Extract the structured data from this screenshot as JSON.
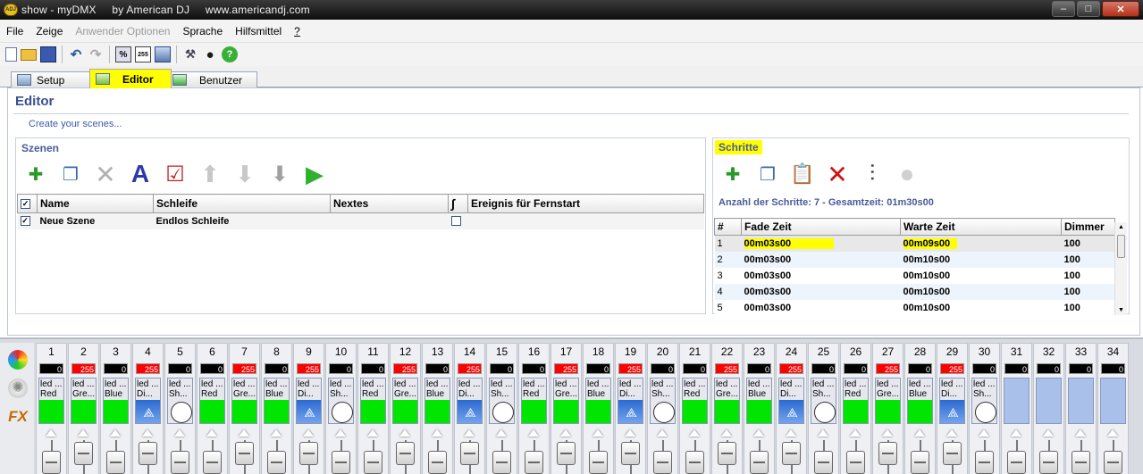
{
  "window": {
    "title": "show - myDMX     by American DJ     www.americandj.com",
    "minimize": "–",
    "maximize": "□",
    "close": "✕"
  },
  "menu": [
    {
      "label": "File",
      "enabled": true
    },
    {
      "label": "Zeige",
      "enabled": true
    },
    {
      "label": "Anwender Optionen",
      "enabled": false
    },
    {
      "label": "Sprache",
      "enabled": true
    },
    {
      "label": "Hilfsmittel",
      "enabled": true
    },
    {
      "label": "?",
      "enabled": true
    }
  ],
  "toolbar_icons": [
    "new-file-icon",
    "open-folder-icon",
    "save-icon",
    "undo-icon",
    "redo-icon",
    "percent-icon",
    "dmx-255-icon",
    "window-icon",
    "tools-icon",
    "record-icon",
    "help-icon"
  ],
  "toolbar_255": "255",
  "tabs": [
    {
      "label": "Setup",
      "active": false
    },
    {
      "label": "Editor",
      "active": true
    },
    {
      "label": "Benutzer",
      "active": false
    }
  ],
  "editor": {
    "title": "Editor",
    "subtitle": "Create your scenes..."
  },
  "szenen": {
    "title": "Szenen",
    "icons": [
      "add-scene-icon",
      "copy-scene-icon",
      "delete-scene-icon",
      "rename-scene-icon",
      "properties-scene-icon",
      "move-up-icon",
      "move-down-icon",
      "import-scene-icon",
      "play-scene-icon"
    ],
    "columns": [
      "Name",
      "Schleife",
      "Nextes",
      "Ereignis für Fernstart"
    ],
    "rows": [
      {
        "name": "Neue Szene",
        "schleife": "Endlos Schleife",
        "nextes": "",
        "checked": true
      }
    ]
  },
  "schritte": {
    "title": "Schritte",
    "icons": [
      "add-step-icon",
      "copy-step-icon",
      "paste-step-icon",
      "delete-step-icon",
      "fader-step-icon",
      "record-step-icon"
    ],
    "info": "Anzahl der Schritte: 7 - Gesamtzeit: 01m30s00",
    "columns": [
      "#",
      "Fade Zeit",
      "Warte Zeit",
      "Dimmer"
    ],
    "rows": [
      {
        "n": "1",
        "fade": "00m03s00",
        "warte": "00m09s00",
        "dimmer": "100"
      },
      {
        "n": "2",
        "fade": "00m03s00",
        "warte": "00m10s00",
        "dimmer": "100"
      },
      {
        "n": "3",
        "fade": "00m03s00",
        "warte": "00m10s00",
        "dimmer": "100"
      },
      {
        "n": "4",
        "fade": "00m03s00",
        "warte": "00m10s00",
        "dimmer": "100"
      },
      {
        "n": "5",
        "fade": "00m03s00",
        "warte": "00m10s00",
        "dimmer": "100"
      }
    ]
  },
  "colors": {
    "green": "#00e600",
    "red": "#ff0000",
    "card_blank": "#a8c0ea",
    "hl": "#ffff00"
  },
  "side_icons": [
    "palette-icon",
    "effect-icon",
    "fx-icon"
  ],
  "side_fx": "FX",
  "channels": [
    {
      "num": "1",
      "value": "0",
      "name": "led ...",
      "type": "Red",
      "kind": "green",
      "fader": 0
    },
    {
      "num": "2",
      "value": "255",
      "name": "led ...",
      "type": "Gre...",
      "kind": "green",
      "fader": 1
    },
    {
      "num": "3",
      "value": "0",
      "name": "led ...",
      "type": "Blue",
      "kind": "green",
      "fader": 0
    },
    {
      "num": "4",
      "value": "255",
      "name": "led ...",
      "type": "Di...",
      "kind": "light",
      "fader": 1
    },
    {
      "num": "5",
      "value": "0",
      "name": "led ...",
      "type": "Sh...",
      "kind": "circle",
      "fader": 0
    },
    {
      "num": "6",
      "value": "0",
      "name": "led ...",
      "type": "Red",
      "kind": "green",
      "fader": 0
    },
    {
      "num": "7",
      "value": "255",
      "name": "led ...",
      "type": "Gre...",
      "kind": "green",
      "fader": 1
    },
    {
      "num": "8",
      "value": "0",
      "name": "led ...",
      "type": "Blue",
      "kind": "green",
      "fader": 0
    },
    {
      "num": "9",
      "value": "255",
      "name": "led ...",
      "type": "Di...",
      "kind": "light",
      "fader": 1
    },
    {
      "num": "10",
      "value": "0",
      "name": "led ...",
      "type": "Sh...",
      "kind": "circle",
      "fader": 0
    },
    {
      "num": "11",
      "value": "0",
      "name": "led ...",
      "type": "Red",
      "kind": "green",
      "fader": 0
    },
    {
      "num": "12",
      "value": "255",
      "name": "led ...",
      "type": "Gre...",
      "kind": "green",
      "fader": 1
    },
    {
      "num": "13",
      "value": "0",
      "name": "led ...",
      "type": "Blue",
      "kind": "green",
      "fader": 0
    },
    {
      "num": "14",
      "value": "255",
      "name": "led ...",
      "type": "Di...",
      "kind": "light",
      "fader": 1
    },
    {
      "num": "15",
      "value": "0",
      "name": "led ...",
      "type": "Sh...",
      "kind": "circle",
      "fader": 0
    },
    {
      "num": "16",
      "value": "0",
      "name": "led ...",
      "type": "Red",
      "kind": "green",
      "fader": 0
    },
    {
      "num": "17",
      "value": "255",
      "name": "led ...",
      "type": "Gre...",
      "kind": "green",
      "fader": 1
    },
    {
      "num": "18",
      "value": "0",
      "name": "led ...",
      "type": "Blue",
      "kind": "green",
      "fader": 0
    },
    {
      "num": "19",
      "value": "255",
      "name": "led ...",
      "type": "Di...",
      "kind": "light",
      "fader": 1
    },
    {
      "num": "20",
      "value": "0",
      "name": "led ...",
      "type": "Sh...",
      "kind": "circle",
      "fader": 0
    },
    {
      "num": "21",
      "value": "0",
      "name": "led ...",
      "type": "Red",
      "kind": "green",
      "fader": 0
    },
    {
      "num": "22",
      "value": "255",
      "name": "led ...",
      "type": "Gre...",
      "kind": "green",
      "fader": 1
    },
    {
      "num": "23",
      "value": "0",
      "name": "led ...",
      "type": "Blue",
      "kind": "green",
      "fader": 0
    },
    {
      "num": "24",
      "value": "255",
      "name": "led ...",
      "type": "Di...",
      "kind": "light",
      "fader": 1
    },
    {
      "num": "25",
      "value": "0",
      "name": "led ...",
      "type": "Sh...",
      "kind": "circle",
      "fader": 0
    },
    {
      "num": "26",
      "value": "0",
      "name": "led ...",
      "type": "Red",
      "kind": "green",
      "fader": 0
    },
    {
      "num": "27",
      "value": "255",
      "name": "led ...",
      "type": "Gre...",
      "kind": "green",
      "fader": 1
    },
    {
      "num": "28",
      "value": "0",
      "name": "led ...",
      "type": "Blue",
      "kind": "green",
      "fader": 0
    },
    {
      "num": "29",
      "value": "255",
      "name": "led ...",
      "type": "Di...",
      "kind": "light",
      "fader": 1
    },
    {
      "num": "30",
      "value": "0",
      "name": "led ...",
      "type": "Sh...",
      "kind": "circle",
      "fader": 0
    },
    {
      "num": "31",
      "value": "0",
      "name": "",
      "type": "",
      "kind": "blank",
      "fader": 0
    },
    {
      "num": "32",
      "value": "0",
      "name": "",
      "type": "",
      "kind": "blank",
      "fader": 0
    },
    {
      "num": "33",
      "value": "0",
      "name": "",
      "type": "",
      "kind": "blank",
      "fader": 0
    },
    {
      "num": "34",
      "value": "0",
      "name": "",
      "type": "",
      "kind": "blank",
      "fader": 0
    }
  ]
}
